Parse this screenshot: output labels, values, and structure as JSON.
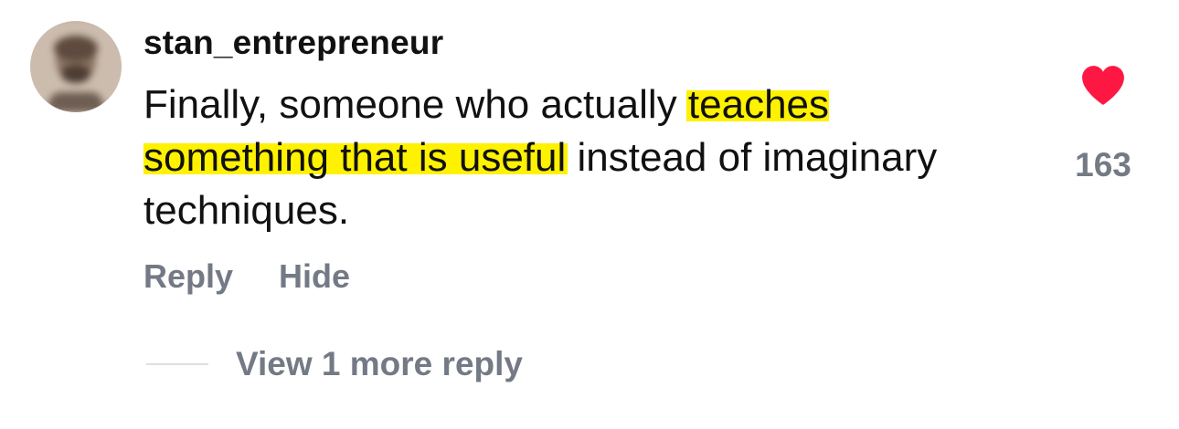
{
  "comment": {
    "username": "stan_entrepreneur",
    "text_before": "Finally, someone who actually ",
    "highlighted_text": "teaches something that is useful",
    "text_after": " instead of imaginary techniques.",
    "highlight_color": "#fff200"
  },
  "actions": {
    "reply_label": "Reply",
    "hide_label": "Hide"
  },
  "likes": {
    "count": "163",
    "icon": "heart-icon",
    "liked": true,
    "color": "#ff1744"
  },
  "replies": {
    "view_label": "View 1 more reply"
  },
  "avatar": {
    "icon": "avatar-blurred"
  }
}
